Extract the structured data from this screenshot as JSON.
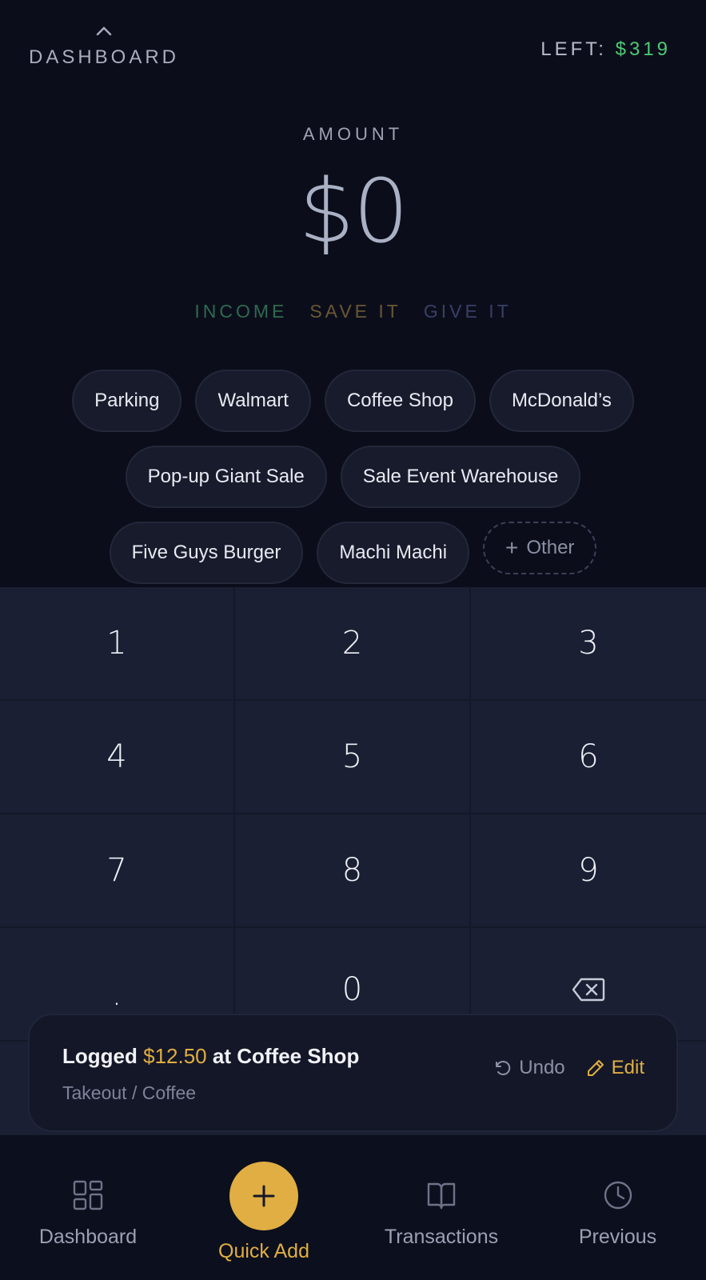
{
  "header": {
    "dashboard_label": "DASHBOARD",
    "left_label": "LEFT:",
    "left_value": "$319"
  },
  "amount": {
    "label": "AMOUNT",
    "value": "$0"
  },
  "modes": [
    {
      "label": "INCOME",
      "color": "#2e6a4f"
    },
    {
      "label": "SAVE IT",
      "color": "#6a5634"
    },
    {
      "label": "GIVE IT",
      "color": "#3a3f66"
    }
  ],
  "chips": {
    "row1": [
      "Parking",
      "Walmart",
      "Coffee Shop",
      "McDonald’s"
    ],
    "row2": [
      "Pop-up Giant Sale",
      "Sale Event Warehouse"
    ],
    "row3": [
      "Five Guys Burger",
      "Machi Machi"
    ],
    "other_label": "Other"
  },
  "keypad": {
    "keys": [
      "1",
      "2",
      "3",
      "4",
      "5",
      "6",
      "7",
      "8",
      "9",
      ".",
      "0"
    ],
    "backspace_icon": "backspace-icon"
  },
  "toast": {
    "prefix": "Logged",
    "amount": "$12.50",
    "suffix": "at Coffee Shop",
    "subtitle": "Takeout / Coffee",
    "undo_label": "Undo",
    "edit_label": "Edit"
  },
  "nav": {
    "dashboard": "Dashboard",
    "quick_add": "Quick Add",
    "transactions": "Transactions",
    "previous": "Previous"
  },
  "colors": {
    "accent": "#e0ae42",
    "positive": "#4ccb75",
    "background": "#0b0e1a",
    "keypad": "#1b1f33"
  }
}
